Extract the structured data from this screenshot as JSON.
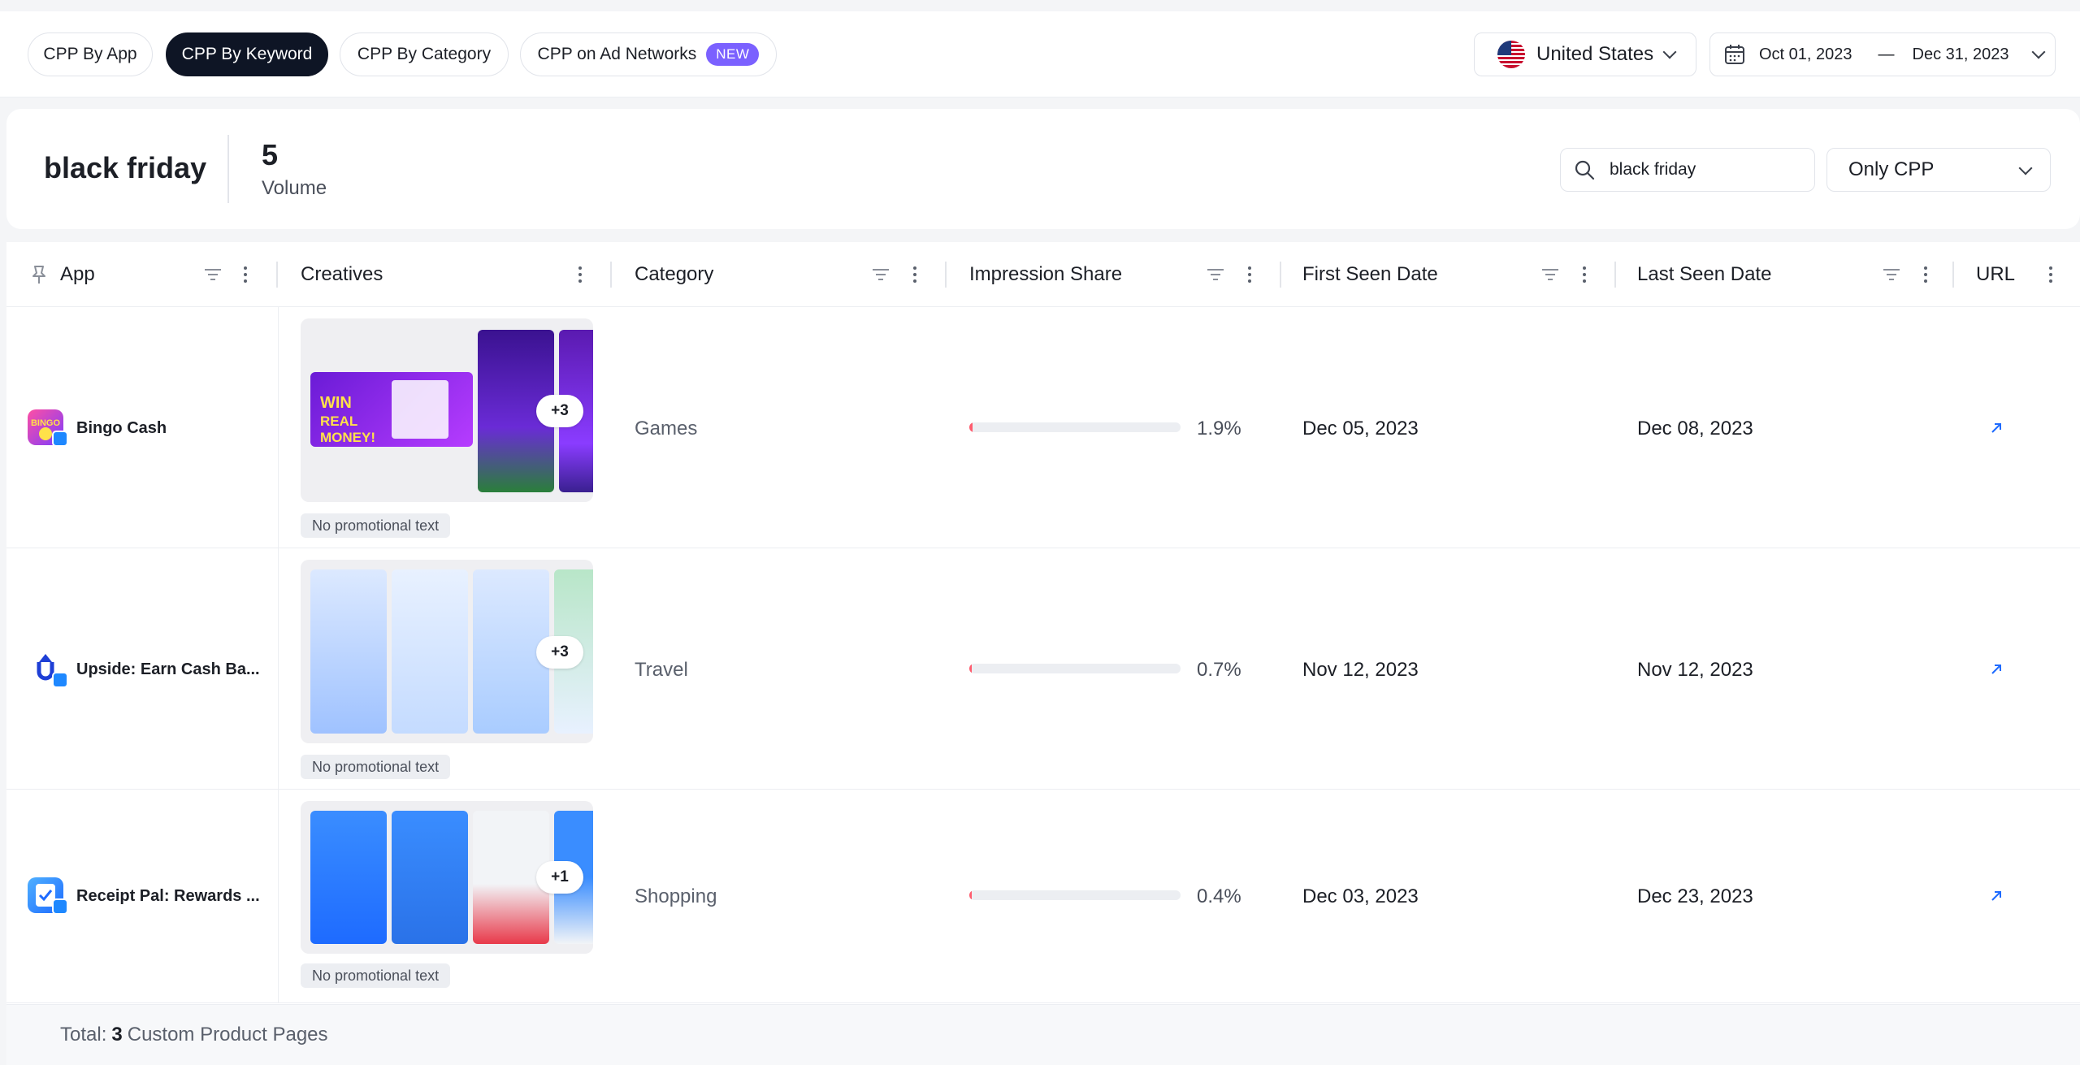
{
  "tabs": [
    {
      "label": "CPP By App",
      "active": false
    },
    {
      "label": "CPP By Keyword",
      "active": true
    },
    {
      "label": "CPP By Category",
      "active": false
    },
    {
      "label": "CPP on Ad Networks",
      "active": false,
      "badge": "NEW"
    }
  ],
  "country": {
    "label": "United States"
  },
  "date_range": {
    "start": "Oct 01, 2023",
    "separator": "—",
    "end": "Dec 31, 2023"
  },
  "keyword": {
    "term": "black friday",
    "volume": "5",
    "volume_label": "Volume"
  },
  "search": {
    "value": "black friday"
  },
  "filter": {
    "selected": "Only CPP"
  },
  "table": {
    "columns": {
      "app": "App",
      "creatives": "Creatives",
      "category": "Category",
      "impression_share": "Impression Share",
      "first_seen": "First Seen Date",
      "last_seen": "Last Seen Date",
      "url": "URL"
    },
    "rows": [
      {
        "app": "Bingo Cash",
        "more": "+3",
        "promo": "No promotional text",
        "category": "Games",
        "share": "1.9%",
        "share_value": 1.9,
        "first_seen": "Dec 05, 2023",
        "last_seen": "Dec 08, 2023"
      },
      {
        "app": "Upside: Earn Cash Ba...",
        "more": "+3",
        "promo": "No promotional text",
        "category": "Travel",
        "share": "0.7%",
        "share_value": 0.7,
        "first_seen": "Nov 12, 2023",
        "last_seen": "Nov 12, 2023"
      },
      {
        "app": "Receipt Pal: Rewards ...",
        "more": "+1",
        "promo": "No promotional text",
        "category": "Shopping",
        "share": "0.4%",
        "share_value": 0.4,
        "first_seen": "Dec 03, 2023",
        "last_seen": "Dec 23, 2023"
      }
    ]
  },
  "footer": {
    "prefix": "Total:",
    "count": "3",
    "suffix": "Custom Product Pages"
  },
  "colors": {
    "accent": "#7b61ff",
    "active_tab": "#0e1525",
    "bar": "#ff5c6e"
  }
}
